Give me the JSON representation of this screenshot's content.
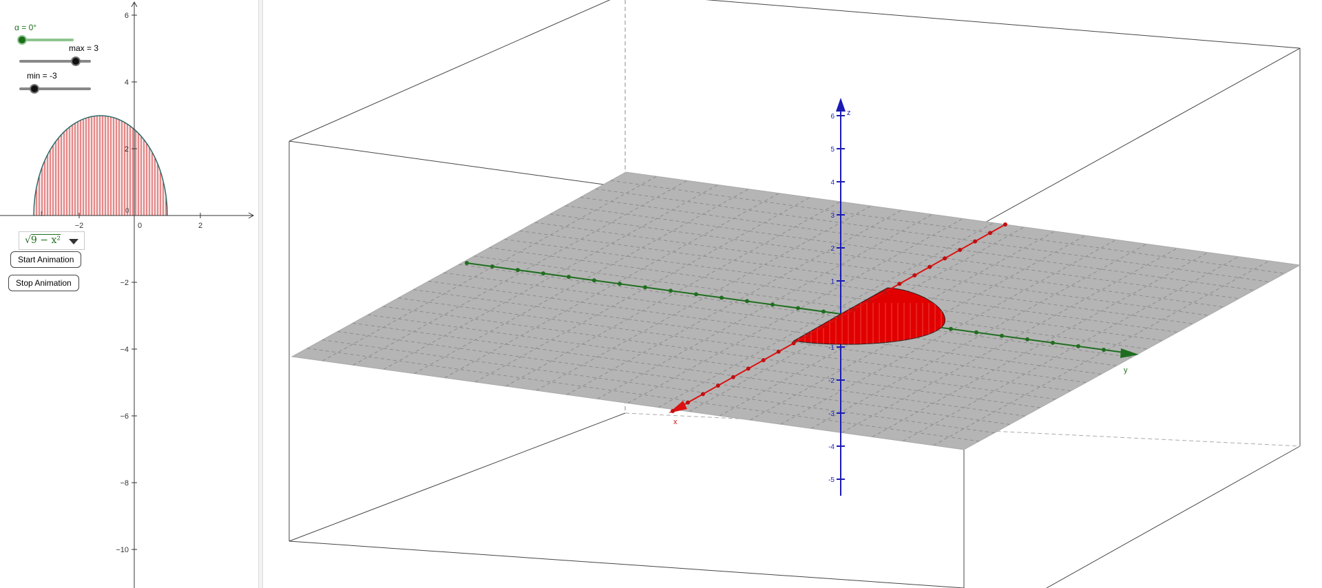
{
  "view2d": {
    "sliders": [
      {
        "label": "α = 0°",
        "color": "#1b6e1b",
        "value_fraction": 0.0
      },
      {
        "label": "max = 3",
        "color": "#000000",
        "value_fraction": 0.85
      },
      {
        "label": "min = -3",
        "color": "#000000",
        "value_fraction": 0.15
      }
    ],
    "y_ticks": [
      "6",
      "4",
      "2",
      "0",
      "−2",
      "−4",
      "−6",
      "−8",
      "−10"
    ],
    "x_ticks": [
      "−2",
      "0",
      "2"
    ],
    "function_name": "f",
    "function_dropdown_value": "9 − x²",
    "buttons": {
      "start": "Start Animation",
      "stop": "Stop Animation"
    },
    "colors": {
      "fill": "#d32f2f",
      "curve": "#2e6b6b",
      "slider_green": "#1b6e1b"
    }
  },
  "view3d": {
    "axis_labels": {
      "x": "x",
      "y": "y",
      "z": "z"
    },
    "z_ticks": [
      "6",
      "5",
      "4",
      "3",
      "2",
      "1",
      "-1",
      "-2",
      "-3",
      "-4",
      "-5"
    ],
    "colors": {
      "x_axis": "#d11",
      "y_axis": "#1f6e1f",
      "z_axis": "#1a1ab5",
      "plane": "#b5b5b5",
      "surface": "#e00000"
    }
  }
}
